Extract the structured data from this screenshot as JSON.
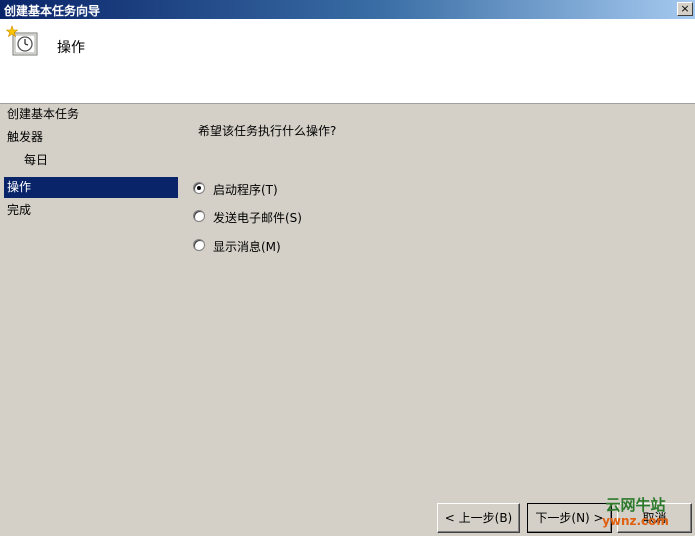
{
  "window": {
    "title": "创建基本任务向导",
    "close_glyph": "×"
  },
  "header": {
    "title": "操作",
    "icon": "task-clock-icon"
  },
  "sidebar": {
    "items": [
      {
        "label": "创建基本任务"
      },
      {
        "label": "触发器"
      },
      {
        "label": "每日"
      },
      {
        "label": "操作"
      },
      {
        "label": "完成"
      }
    ]
  },
  "main": {
    "prompt": "希望该任务执行什么操作?",
    "options": [
      {
        "label": "启动程序(T)",
        "selected": true
      },
      {
        "label": "发送电子邮件(S)",
        "selected": false
      },
      {
        "label": "显示消息(M)",
        "selected": false
      }
    ]
  },
  "buttons": {
    "back": "< 上一步(B)",
    "next": "下一步(N) >",
    "cancel": "取消"
  },
  "watermark": {
    "line1": "云网牛站",
    "line2": "ywnz.com"
  },
  "colors": {
    "selection": "#0a246a",
    "face": "#d4d0c8"
  }
}
